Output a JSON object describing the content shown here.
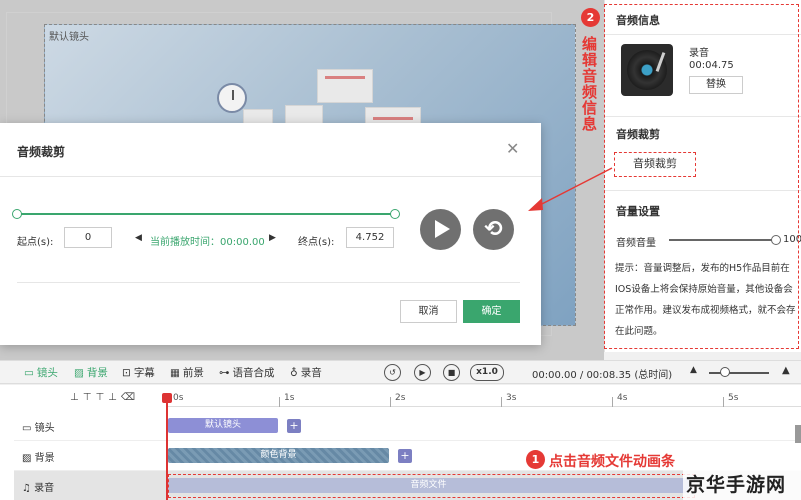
{
  "stage": {
    "label": "默认镜头"
  },
  "right_panel": {
    "audio_info_title": "音频信息",
    "audio_name": "录音",
    "audio_duration": "00:04.75",
    "replace_button": "替换",
    "crop_title": "音频裁剪",
    "crop_button": "音频裁剪",
    "volume_title": "音量设置",
    "volume_label": "音频音量",
    "volume_value": "100",
    "volume_level": 1.0,
    "tip": "提示：音量调整后，发布的H5作品目前在IOS设备上将会保持原始音量，其他设备会正常作用。建议发布成视频格式，就不会存在此问题。"
  },
  "annotations": {
    "step2_number": "2",
    "step2_text": "编辑音频信息",
    "step1_number": "1",
    "step1_text": "点击音频文件动画条"
  },
  "dialog": {
    "title": "音频裁剪",
    "close_icon": "close-icon",
    "start_label": "起点(s):",
    "start_value": "0",
    "current_time": "当前播放时间：00:00.00",
    "end_label": "终点(s):",
    "end_value": "4.752",
    "cancel_label": "取消",
    "ok_label": "确定"
  },
  "toolbar": {
    "items": [
      {
        "icon": "camera-icon",
        "label": "镜头"
      },
      {
        "icon": "image-icon",
        "label": "背景"
      },
      {
        "icon": "subtitle-icon",
        "label": "字幕"
      },
      {
        "icon": "grid-icon",
        "label": "前景"
      },
      {
        "icon": "voice-synth-icon",
        "label": "语音合成"
      },
      {
        "icon": "mic-icon",
        "label": "录音"
      }
    ],
    "speed": "x1.0",
    "time_readout": "00:00.00 / 00:08.35 (总时间)"
  },
  "timeline": {
    "ticks": [
      "0s",
      "1s",
      "2s",
      "3s",
      "4s",
      "5s"
    ],
    "tracks": [
      {
        "label": "镜头",
        "clip": "默认镜头"
      },
      {
        "label": "背景",
        "clip": "颜色背景"
      },
      {
        "label": "录音",
        "clip": "音频文件"
      }
    ]
  },
  "watermark": "京华手游网",
  "colors": {
    "accent_green": "#3aa66e",
    "annotation_red": "#e53935"
  }
}
